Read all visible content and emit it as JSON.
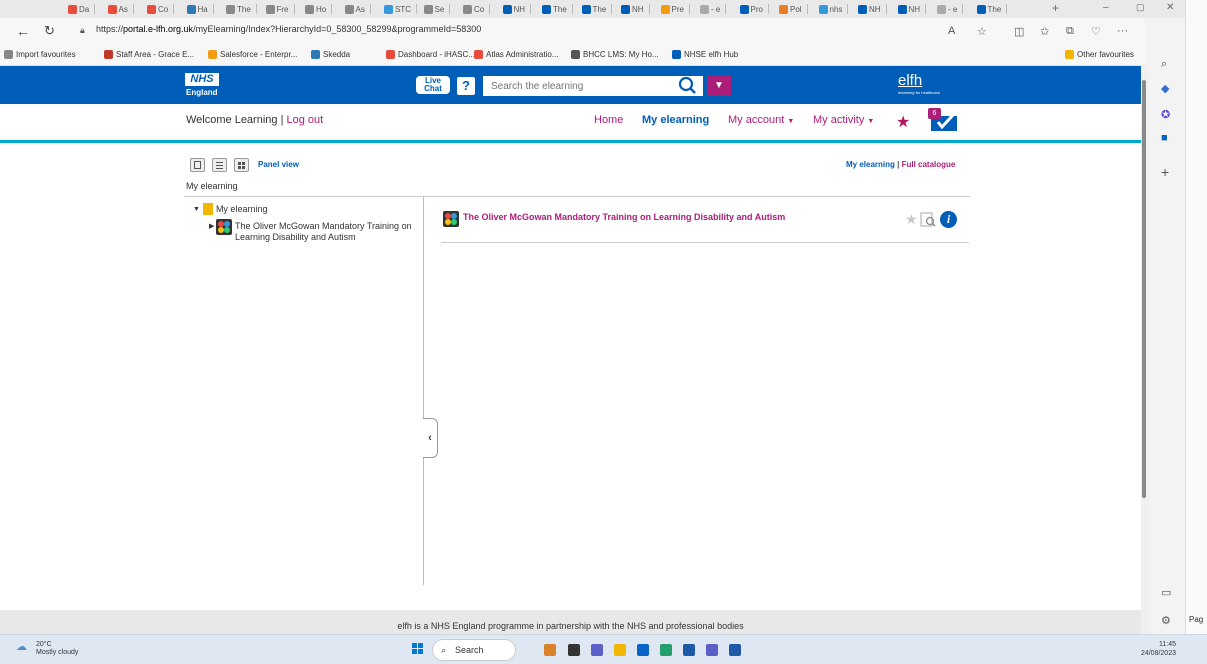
{
  "browser": {
    "tabs": [
      {
        "label": "Da"
      },
      {
        "label": "As"
      },
      {
        "label": "Co"
      },
      {
        "label": "Ha"
      },
      {
        "label": "The"
      },
      {
        "label": "Fre"
      },
      {
        "label": "Ho"
      },
      {
        "label": "As"
      },
      {
        "label": "STC"
      },
      {
        "label": "Se"
      },
      {
        "label": "Co"
      },
      {
        "label": "NH"
      },
      {
        "label": "The"
      },
      {
        "label": "The"
      },
      {
        "label": "NH"
      },
      {
        "label": "Pre"
      },
      {
        "label": "- e"
      },
      {
        "label": "Pro"
      },
      {
        "label": "Pol"
      },
      {
        "label": "nhs"
      },
      {
        "label": "NH"
      },
      {
        "label": "NH"
      },
      {
        "label": "- e"
      },
      {
        "label": "The"
      }
    ],
    "url_prefix": "https://",
    "url_host": "portal.e-lfh.org.uk",
    "url_path": "/myElearning/Index?HierarchyId=0_58300_58299&programmeId=58300",
    "favourites": [
      {
        "label": "Import favourites",
        "color": "#888888"
      },
      {
        "label": "Staff Area - Grace E...",
        "color": "#c0392b"
      },
      {
        "label": "Salesforce - Enterpr...",
        "color": "#f39c12"
      },
      {
        "label": "Skedda",
        "color": "#2c7bb6"
      },
      {
        "label": "Dashboard - iHASC...",
        "color": "#e74c3c"
      },
      {
        "label": "Atlas Administratio...",
        "color": "#e74c3c"
      },
      {
        "label": "BHCC LMS: My Ho...",
        "color": "#555555"
      },
      {
        "label": "NHSE elfh Hub",
        "color": "#005eb8"
      }
    ],
    "other_favourites": "Other favourites"
  },
  "site": {
    "logo": "NHS",
    "logo_sub": "England",
    "live_chat_1": "Live",
    "live_chat_2": "Chat",
    "help": "?",
    "search_placeholder": "Search the elearning",
    "brand": "elfh",
    "brand_sub": "elearning for healthcare",
    "welcome": "Welcome Learning | ",
    "logout": "Log out",
    "nav": {
      "home": "Home",
      "my_elearning": "My elearning",
      "my_account": "My account",
      "my_activity": "My activity"
    },
    "notification_count": "6",
    "panel_view": "Panel view",
    "my_elearning_link": "My elearning",
    "separator": " | ",
    "full_catalogue": "Full catalogue",
    "breadcrumb": "My elearning",
    "tree": {
      "root": "My elearning",
      "child": "The Oliver McGowan Mandatory Training on Learning Disability and Autism"
    },
    "course": {
      "title": "The Oliver McGowan Mandatory Training on Learning Disability and Autism",
      "info": "i"
    },
    "footer": "elfh is a NHS England programme in partnership with the NHS and professional bodies"
  },
  "taskbar": {
    "temp": "20°C",
    "weather": "Mostly cloudy",
    "search": "Search",
    "time": "11:45",
    "date": "24/08/2023"
  },
  "edge_sidebar": {
    "right_clip": "Pag"
  },
  "colors": {
    "nhs_blue": "#005eb8",
    "accent_magenta": "#ad1d7a",
    "rule_cyan": "#00a9ce"
  }
}
